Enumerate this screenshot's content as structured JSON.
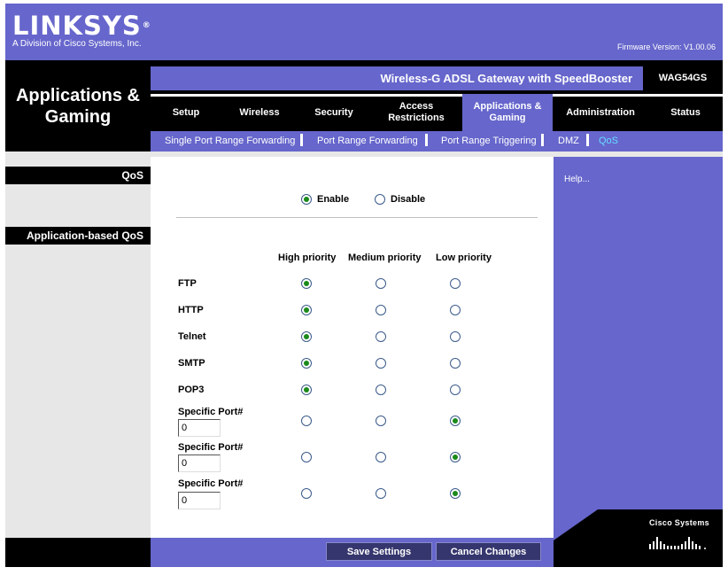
{
  "header": {
    "brand": "LINKSYS",
    "brand_mark": "®",
    "tagline": "A Division of Cisco Systems, Inc.",
    "firmware": "Firmware Version: V1.00.06"
  },
  "section_title": "Applications & Gaming",
  "product": {
    "name": "Wireless-G ADSL Gateway with SpeedBooster",
    "model": "WAG54GS"
  },
  "nav": {
    "tabs": [
      {
        "label": "Setup"
      },
      {
        "label": "Wireless"
      },
      {
        "label": "Security"
      },
      {
        "label": "Access Restrictions"
      },
      {
        "label": "Applications & Gaming"
      },
      {
        "label": "Administration"
      },
      {
        "label": "Status"
      }
    ],
    "active_tab": "Applications & Gaming"
  },
  "subnav": {
    "items": [
      {
        "label": "Single Port Range Forwarding"
      },
      {
        "label": "Port Range Forwarding"
      },
      {
        "label": "Port Range Triggering"
      },
      {
        "label": "DMZ"
      },
      {
        "label": "QoS"
      }
    ],
    "active": "QoS"
  },
  "left_labels": {
    "qos": "QoS",
    "app_qos": "Application-based QoS"
  },
  "qos": {
    "enable_label": "Enable",
    "disable_label": "Disable",
    "selected": "Enable"
  },
  "priority_headers": [
    "High priority",
    "Medium priority",
    "Low priority"
  ],
  "applications": [
    {
      "name": "FTP",
      "priority": "High priority"
    },
    {
      "name": "HTTP",
      "priority": "High priority"
    },
    {
      "name": "Telnet",
      "priority": "High priority"
    },
    {
      "name": "SMTP",
      "priority": "High priority"
    },
    {
      "name": "POP3",
      "priority": "High priority"
    }
  ],
  "specific_ports": [
    {
      "label": "Specific Port#",
      "value": "0",
      "priority": "Low priority"
    },
    {
      "label": "Specific Port#",
      "value": "0",
      "priority": "Low priority"
    },
    {
      "label": "Specific Port#",
      "value": "0",
      "priority": "Low priority"
    }
  ],
  "help_link": "Help...",
  "footer": {
    "save_label": "Save Settings",
    "cancel_label": "Cancel Changes",
    "cisco_label": "Cisco Systems"
  },
  "colors": {
    "brand_purple": "#6666cc",
    "active_link": "#66ddff",
    "radio_checked": "#1a8a1a"
  }
}
